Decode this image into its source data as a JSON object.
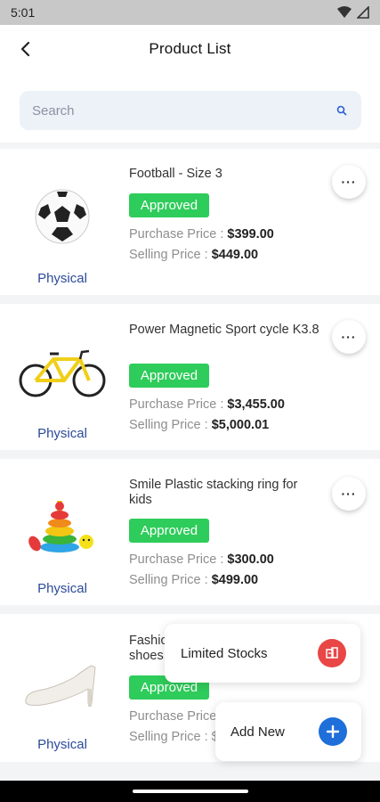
{
  "status_bar": {
    "time": "5:01"
  },
  "header": {
    "title": "Product List"
  },
  "search": {
    "placeholder": "Search"
  },
  "products": [
    {
      "name": "Football - Size 3",
      "status": "Approved",
      "purchase_label": "Purchase Price :",
      "purchase_price": "$399.00",
      "selling_label": "Selling Price :",
      "selling_price": "$449.00",
      "type": "Physical",
      "more": "···"
    },
    {
      "name": "Power Magnetic Sport cycle K3.8",
      "status": "Approved",
      "purchase_label": "Purchase Price :",
      "purchase_price": "$3,455.00",
      "selling_label": "Selling Price :",
      "selling_price": "$5,000.01",
      "type": "Physical",
      "more": "···"
    },
    {
      "name": "Smile Plastic stacking ring for kids",
      "status": "Approved",
      "purchase_label": "Purchase Price :",
      "purchase_price": "$300.00",
      "selling_label": "Selling Price :",
      "selling_price": "$499.00",
      "type": "Physical",
      "more": "···"
    },
    {
      "name_partial_line1": "Fashio",
      "name_partial_line2": "shoes",
      "status": "Approved",
      "purchase_label": "Purchase Price :",
      "selling_label": "Selling Price : $",
      "type": "Physical"
    }
  ],
  "fab_menu": {
    "limited_stocks": "Limited Stocks",
    "add_new": "Add New"
  },
  "colors": {
    "approved": "#2ecc5a",
    "type_text": "#2b4a9a",
    "add_new": "#1e6fd9",
    "limited_stocks": "#e94646"
  }
}
